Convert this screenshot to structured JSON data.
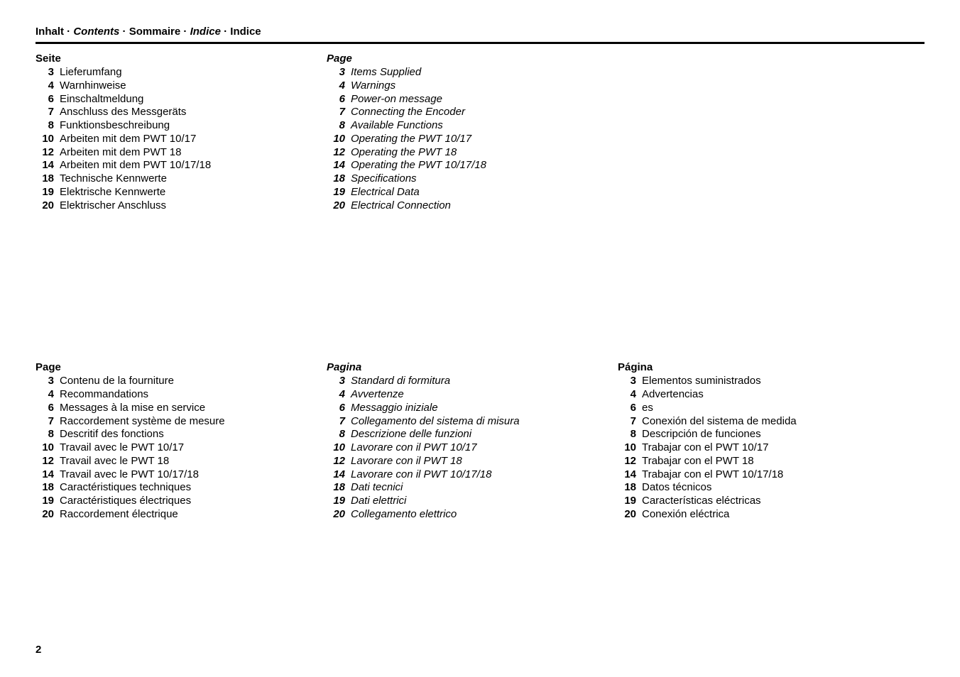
{
  "title_parts": {
    "p0": "Inhalt",
    "p1": "Contents",
    "p2": "Sommaire",
    "p3": "Indice",
    "p4": "Indice",
    "sep": " · "
  },
  "page_number": "2",
  "columns": {
    "de": {
      "heading": "Seite",
      "italic": false,
      "entries": [
        {
          "n": "3",
          "t": "Lieferumfang"
        },
        {
          "n": "4",
          "t": "Warnhinweise"
        },
        {
          "n": "6",
          "t": "Einschaltmeldung"
        },
        {
          "n": "7",
          "t": "Anschluss des Messgeräts"
        },
        {
          "n": "8",
          "t": "Funktionsbeschreibung"
        },
        {
          "n": "10",
          "t": "Arbeiten mit dem PWT 10/17"
        },
        {
          "n": "12",
          "t": "Arbeiten mit dem PWT 18"
        },
        {
          "n": "14",
          "t": "Arbeiten mit dem PWT 10/17/18"
        },
        {
          "n": "18",
          "t": "Technische Kennwerte"
        },
        {
          "n": "19",
          "t": "Elektrische Kennwerte"
        },
        {
          "n": "20",
          "t": "Elektrischer Anschluss"
        }
      ]
    },
    "en": {
      "heading": "Page",
      "italic": true,
      "entries": [
        {
          "n": "3",
          "t": "Items Supplied"
        },
        {
          "n": "4",
          "t": "Warnings"
        },
        {
          "n": "6",
          "t": "Power-on message"
        },
        {
          "n": "7",
          "t": "Connecting the Encoder"
        },
        {
          "n": "8",
          "t": "Available Functions"
        },
        {
          "n": "10",
          "t": "Operating the PWT 10/17"
        },
        {
          "n": "12",
          "t": "Operating the PWT 18"
        },
        {
          "n": "14",
          "t": "Operating the PWT 10/17/18"
        },
        {
          "n": "18",
          "t": "Specifications"
        },
        {
          "n": "19",
          "t": "Electrical Data"
        },
        {
          "n": "20",
          "t": "Electrical Connection"
        }
      ]
    },
    "fr": {
      "heading": "Page",
      "italic": false,
      "entries": [
        {
          "n": "3",
          "t": "Contenu de la fourniture"
        },
        {
          "n": "4",
          "t": "Recommandations"
        },
        {
          "n": "6",
          "t": "Messages à la mise en service"
        },
        {
          "n": "7",
          "t": "Raccordement système de mesure"
        },
        {
          "n": "8",
          "t": "Descritif des fonctions"
        },
        {
          "n": "10",
          "t": "Travail avec le PWT 10/17"
        },
        {
          "n": "12",
          "t": "Travail avec le PWT 18"
        },
        {
          "n": "14",
          "t": "Travail avec le PWT 10/17/18"
        },
        {
          "n": "18",
          "t": "Caractéristiques techniques"
        },
        {
          "n": "19",
          "t": "Caractéristiques électriques"
        },
        {
          "n": "20",
          "t": "Raccordement électrique"
        }
      ]
    },
    "it": {
      "heading": "Pagina",
      "italic": true,
      "entries": [
        {
          "n": "3",
          "t": "Standard di formitura"
        },
        {
          "n": "4",
          "t": "Avvertenze"
        },
        {
          "n": "6",
          "t": "Messaggio iniziale"
        },
        {
          "n": "7",
          "t": "Collegamento del sistema di misura"
        },
        {
          "n": "8",
          "t": "Descrizione delle funzioni"
        },
        {
          "n": "10",
          "t": "Lavorare con il PWT 10/17"
        },
        {
          "n": "12",
          "t": "Lavorare con il PWT 18"
        },
        {
          "n": "14",
          "t": "Lavorare con il PWT 10/17/18"
        },
        {
          "n": "18",
          "t": "Dati tecnici"
        },
        {
          "n": "19",
          "t": "Dati elettrici"
        },
        {
          "n": "20",
          "t": "Collegamento elettrico"
        }
      ]
    },
    "es": {
      "heading": "Página",
      "italic": false,
      "entries": [
        {
          "n": "3",
          "t": "Elementos suministrados"
        },
        {
          "n": "4",
          "t": "Advertencias"
        },
        {
          "n": "6",
          "t": "es"
        },
        {
          "n": "7",
          "t": "Conexión del sistema de medida"
        },
        {
          "n": "8",
          "t": "Descripción de funciones"
        },
        {
          "n": "10",
          "t": "Trabajar con el PWT 10/17"
        },
        {
          "n": "12",
          "t": "Trabajar con el PWT 18"
        },
        {
          "n": "14",
          "t": "Trabajar con el PWT 10/17/18"
        },
        {
          "n": "18",
          "t": "Datos técnicos"
        },
        {
          "n": "19",
          "t": "Características eléctricas"
        },
        {
          "n": "20",
          "t": "Conexión eléctrica"
        }
      ]
    }
  }
}
